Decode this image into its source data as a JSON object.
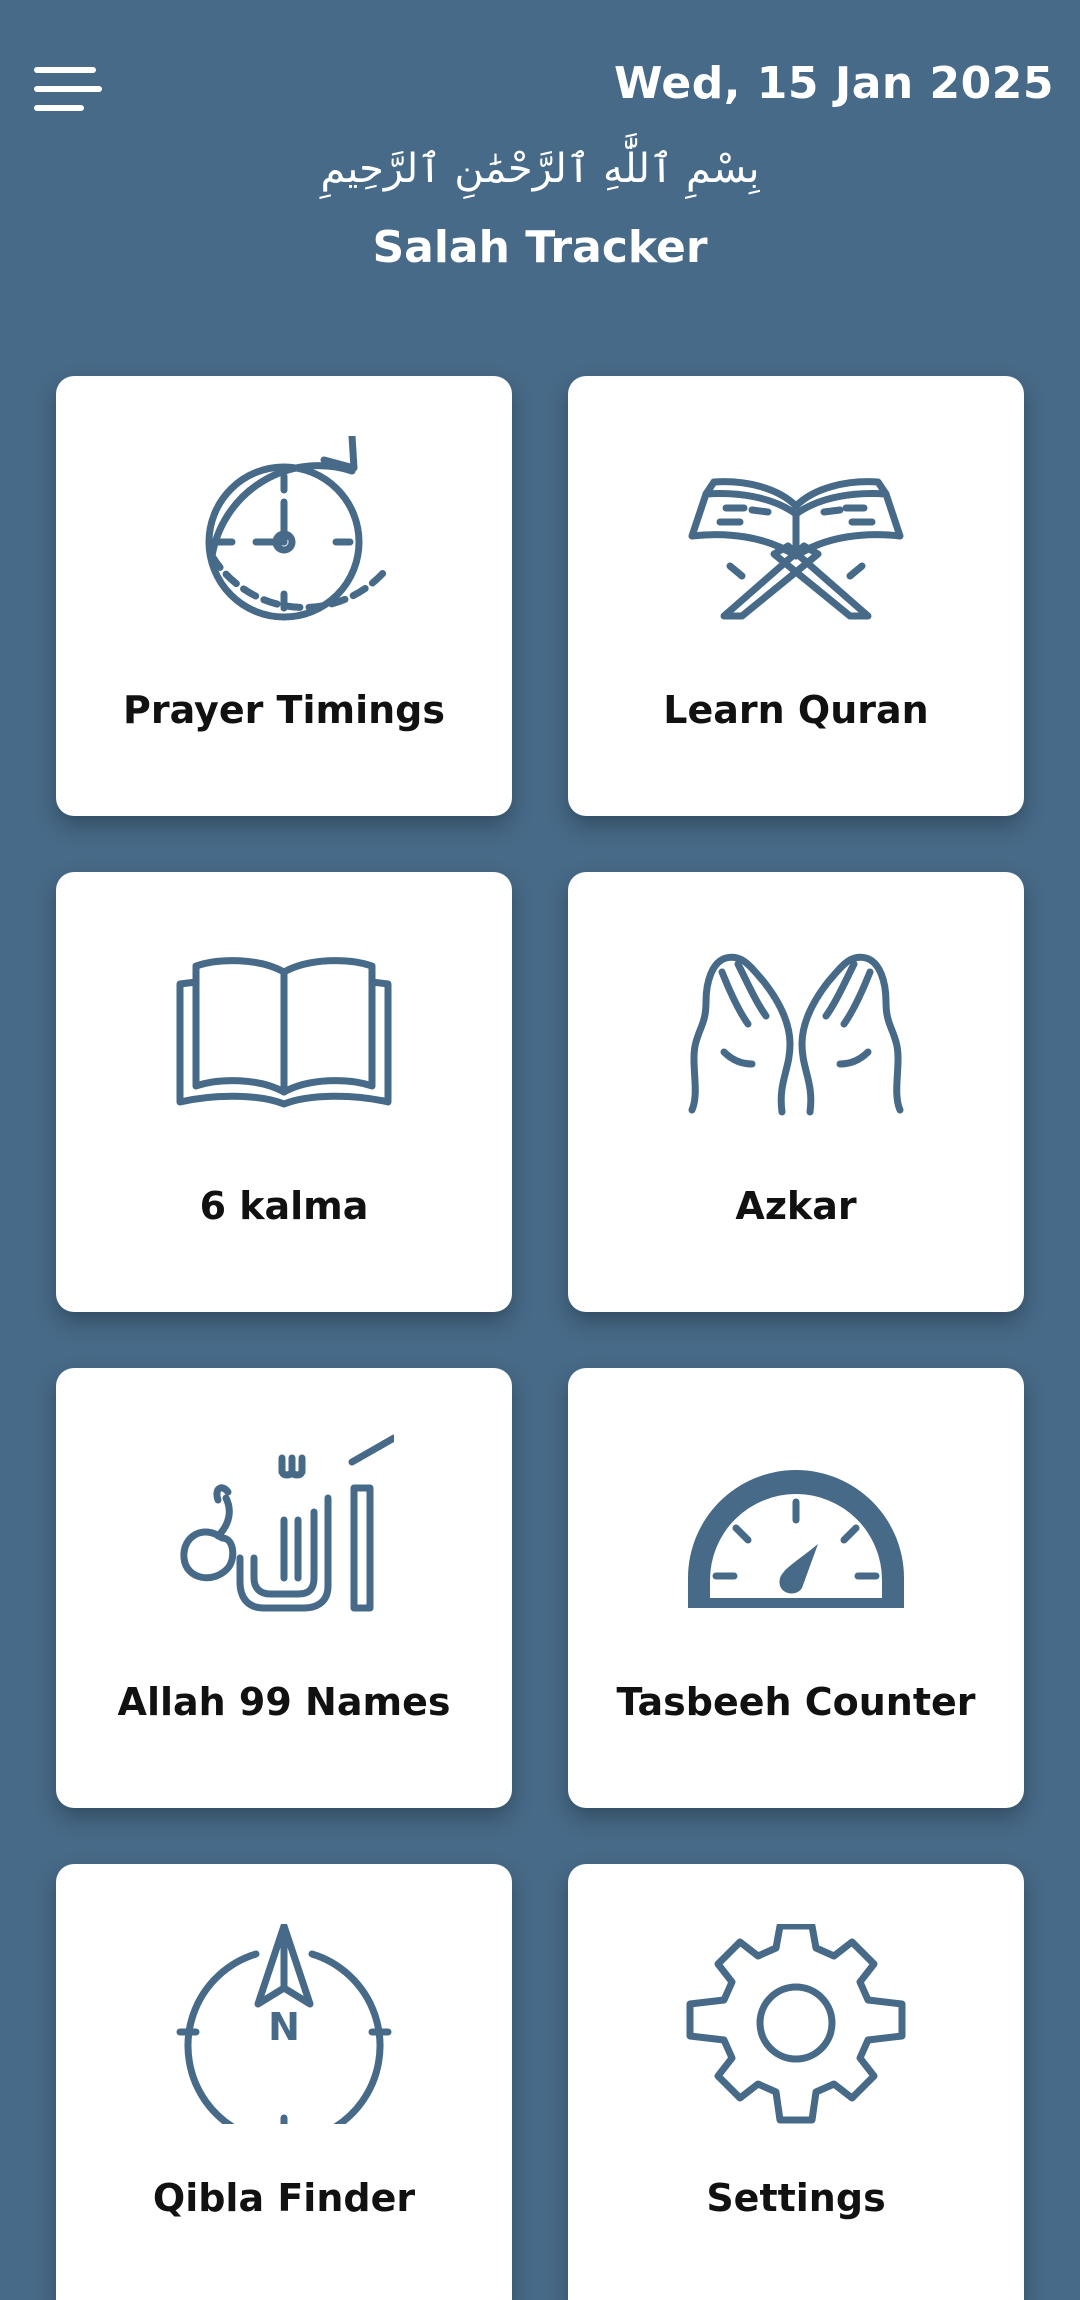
{
  "header": {
    "menu_icon": "hamburger-menu-icon",
    "date": "Wed, 15 Jan 2025",
    "bismillah": "بِسْمِ ٱللَّٰهِ ٱلرَّحْمَٰنِ ٱلرَّحِيمِ",
    "title": "Salah Tracker"
  },
  "colors": {
    "background": "#476a88",
    "card": "#ffffff",
    "icon": "#476a88",
    "label": "#111111"
  },
  "grid": {
    "items": [
      {
        "label": "Prayer Timings",
        "icon": "clock-refresh-icon"
      },
      {
        "label": "Learn Quran",
        "icon": "quran-stand-icon"
      },
      {
        "label": "6 kalma",
        "icon": "open-book-icon"
      },
      {
        "label": "Azkar",
        "icon": "praying-hands-icon"
      },
      {
        "label": "Allah 99 Names",
        "icon": "allah-calligraphy-icon"
      },
      {
        "label": "Tasbeeh Counter",
        "icon": "speedometer-icon"
      },
      {
        "label": "Qibla Finder",
        "icon": "compass-icon"
      },
      {
        "label": "Settings",
        "icon": "gear-icon"
      }
    ],
    "compass_letter": "N",
    "allah_text": "الله"
  }
}
